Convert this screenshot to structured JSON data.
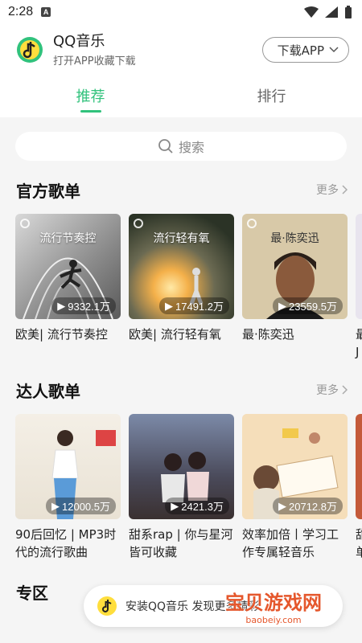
{
  "status_bar": {
    "time": "2:28",
    "notif_letter": "A"
  },
  "app": {
    "name": "QQ音乐",
    "subtitle": "打开APP收藏下载",
    "download_label": "下载APP",
    "accent": "#31c27c"
  },
  "tabs": [
    {
      "label": "推荐"
    },
    {
      "label": "排行"
    }
  ],
  "search": {
    "placeholder": "搜索"
  },
  "sections": [
    {
      "title": "官方歌单",
      "more": "更多",
      "cards": [
        {
          "caption": "流行节奏控",
          "plays": "9332.1万",
          "title": "欧美| 流行节奏控"
        },
        {
          "caption": "流行轻有氧",
          "plays": "17491.2万",
          "title": "欧美| 流行轻有氧"
        },
        {
          "caption": "最·陈奕迅",
          "plays": "23559.5万",
          "title": "最·陈奕迅"
        },
        {
          "title_partial": "最 J"
        }
      ]
    },
    {
      "title": "达人歌单",
      "more": "更多",
      "cards": [
        {
          "plays": "12000.5万",
          "title": "90后回忆 | MP3时代的流行歌曲"
        },
        {
          "plays": "2421.3万",
          "title": "甜系rap | 你与星河皆可收藏"
        },
        {
          "plays": "20712.8万",
          "title": "效率加倍丨学习工作专属轻音乐"
        },
        {
          "title_partial": "甜 单"
        }
      ]
    },
    {
      "title": "专区"
    }
  ],
  "banner": {
    "text": "安装QQ音乐 发现更多精彩"
  },
  "watermark": {
    "text": "宝贝游戏网",
    "url": "baobeiy.com"
  }
}
